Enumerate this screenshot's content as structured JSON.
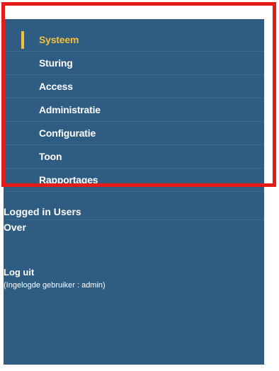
{
  "menu": {
    "items": [
      {
        "label": "Systeem",
        "active": true
      },
      {
        "label": "Sturing",
        "active": false
      },
      {
        "label": "Access",
        "active": false
      },
      {
        "label": "Administratie",
        "active": false
      },
      {
        "label": "Configuratie",
        "active": false
      },
      {
        "label": "Toon",
        "active": false
      },
      {
        "label": "Rapportages",
        "active": false
      }
    ]
  },
  "lower": {
    "logged_in_users": "Logged in Users",
    "over": "Over"
  },
  "logout": {
    "label": "Log uit",
    "user_info": "(Ingelogde gebruiker : admin)"
  },
  "colors": {
    "sidebar_bg": "#2f5c83",
    "active": "#f2c13a",
    "highlight": "#e41b17"
  }
}
